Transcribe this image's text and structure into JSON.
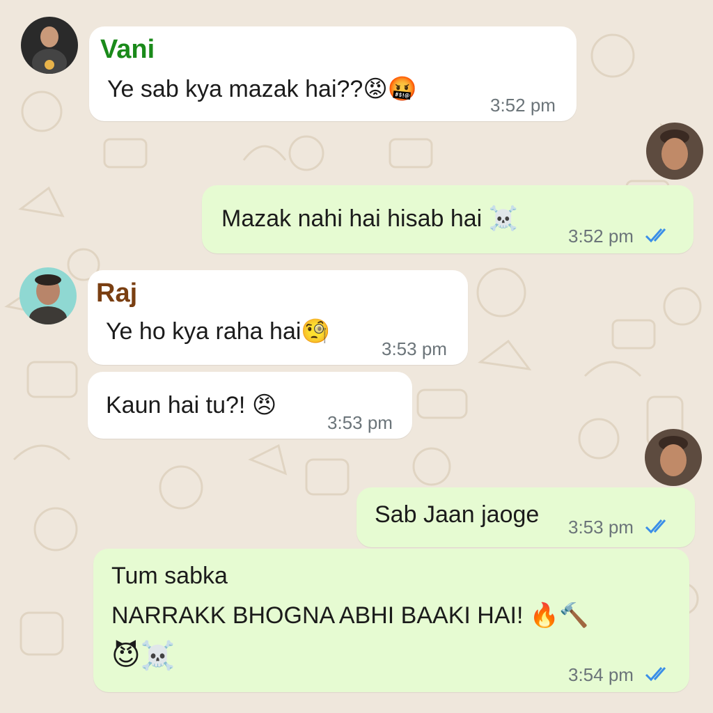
{
  "colors": {
    "wallpaper": "#efe7dc",
    "incoming_bubble": "#ffffff",
    "outgoing_bubble": "#e6fbd2",
    "vani_name": "#1a8a1a",
    "raj_name": "#7a3f12",
    "read_ticks": "#3a8ee8"
  },
  "messages": {
    "m1": {
      "sender": "Vani",
      "text": "Ye sab kya mazak hai??",
      "emoji": "😡🤬",
      "time": "3:52 pm"
    },
    "m2": {
      "text": "Mazak nahi hai hisab hai",
      "emoji": "☠️",
      "time": "3:52 pm",
      "status": "read"
    },
    "m3": {
      "sender": "Raj",
      "text": "Ye ho kya raha hai",
      "emoji": "🧐",
      "time": "3:53 pm"
    },
    "m4": {
      "text": "Kaun hai tu?!",
      "emoji": "😠",
      "time": "3:53 pm"
    },
    "m5": {
      "text": "Sab Jaan jaoge",
      "time": "3:53 pm",
      "status": "read"
    },
    "m6": {
      "line1": "Tum sabka",
      "line2": "NARRAKK BHOGNA ABHI BAAKI HAI!",
      "line2_emoji": "🔥🔨",
      "line3_emoji": "😈☠️",
      "time": "3:54 pm",
      "status": "read"
    }
  }
}
